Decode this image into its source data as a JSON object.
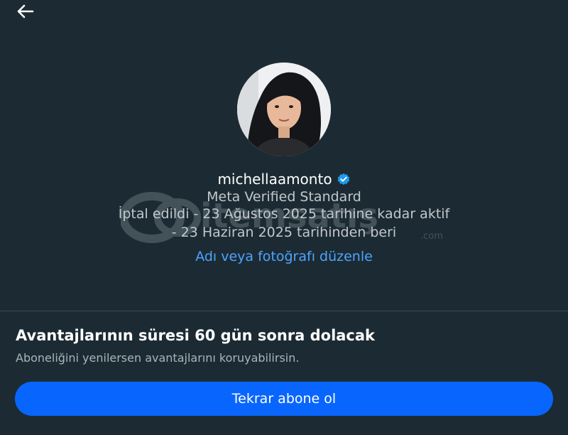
{
  "header": {
    "back_icon": "arrow-left-icon"
  },
  "profile": {
    "username": "michellaamonto",
    "verified_icon": "verified-badge-icon",
    "plan": "Meta Verified Standard",
    "status_line1": "İptal edildi - 23 Ağustos 2025 tarihine kadar aktif",
    "status_line2": "- 23 Haziran 2025 tarihinden beri",
    "edit_link": "Adı veya fotoğrafı düzenle"
  },
  "watermark": {
    "brand": "itemsatış",
    "suffix": ".com"
  },
  "expiry": {
    "title": "Avantajlarının süresi 60 gün sonra dolacak",
    "subtitle": "Aboneliğini yenilersen avantajlarını koruyabilirsin."
  },
  "cta": {
    "label": "Tekrar abone ol"
  },
  "colors": {
    "background": "#1c2b33",
    "accent": "#0866ff",
    "link": "#4da3ff",
    "verified": "#1d9bf0"
  }
}
